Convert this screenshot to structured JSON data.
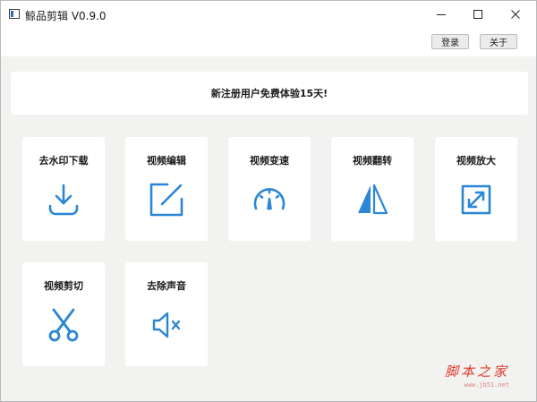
{
  "window": {
    "title": "鲸品剪辑 V0.9.0",
    "icons": {
      "app": "app-window-icon",
      "minimize": "minimize-icon",
      "maximize": "maximize-icon",
      "close": "close-icon"
    }
  },
  "toolbar": {
    "login_label": "登录",
    "about_label": "关于"
  },
  "banner": {
    "text": "新注册用户免费体验15天!"
  },
  "features": [
    {
      "label": "去水印下载",
      "icon": "download-icon"
    },
    {
      "label": "视频编辑",
      "icon": "edit-icon"
    },
    {
      "label": "视频变速",
      "icon": "speedometer-icon"
    },
    {
      "label": "视频翻转",
      "icon": "flip-icon"
    },
    {
      "label": "视频放大",
      "icon": "expand-icon"
    },
    {
      "label": "视频剪切",
      "icon": "scissors-icon"
    },
    {
      "label": "去除声音",
      "icon": "mute-icon"
    }
  ],
  "watermark": {
    "text": "脚本之家",
    "url": "www.jb51.net"
  },
  "colors": {
    "accent": "#2b86d6",
    "background": "#f2f2f0",
    "card": "#ffffff"
  }
}
